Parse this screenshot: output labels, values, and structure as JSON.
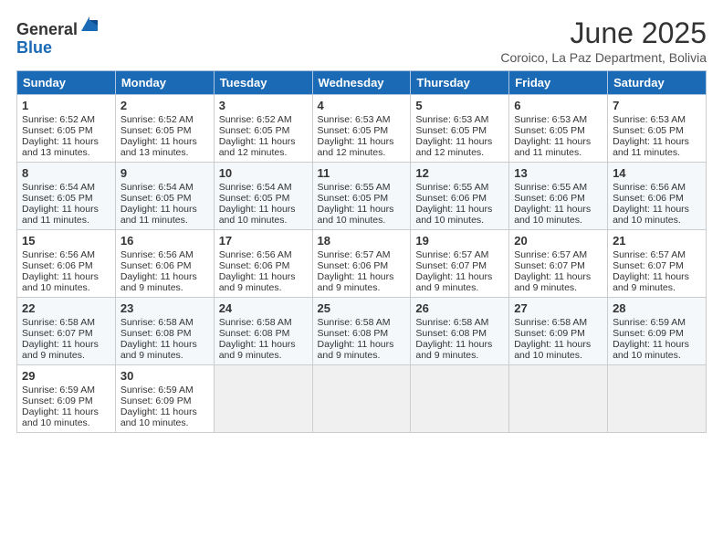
{
  "header": {
    "logo_general": "General",
    "logo_blue": "Blue",
    "title": "June 2025",
    "subtitle": "Coroico, La Paz Department, Bolivia"
  },
  "weekdays": [
    "Sunday",
    "Monday",
    "Tuesday",
    "Wednesday",
    "Thursday",
    "Friday",
    "Saturday"
  ],
  "weeks": [
    [
      {
        "day": "1",
        "sunrise": "6:52 AM",
        "sunset": "6:05 PM",
        "daylight": "11 hours and 13 minutes."
      },
      {
        "day": "2",
        "sunrise": "6:52 AM",
        "sunset": "6:05 PM",
        "daylight": "11 hours and 13 minutes."
      },
      {
        "day": "3",
        "sunrise": "6:52 AM",
        "sunset": "6:05 PM",
        "daylight": "11 hours and 12 minutes."
      },
      {
        "day": "4",
        "sunrise": "6:53 AM",
        "sunset": "6:05 PM",
        "daylight": "11 hours and 12 minutes."
      },
      {
        "day": "5",
        "sunrise": "6:53 AM",
        "sunset": "6:05 PM",
        "daylight": "11 hours and 12 minutes."
      },
      {
        "day": "6",
        "sunrise": "6:53 AM",
        "sunset": "6:05 PM",
        "daylight": "11 hours and 11 minutes."
      },
      {
        "day": "7",
        "sunrise": "6:53 AM",
        "sunset": "6:05 PM",
        "daylight": "11 hours and 11 minutes."
      }
    ],
    [
      {
        "day": "8",
        "sunrise": "6:54 AM",
        "sunset": "6:05 PM",
        "daylight": "11 hours and 11 minutes."
      },
      {
        "day": "9",
        "sunrise": "6:54 AM",
        "sunset": "6:05 PM",
        "daylight": "11 hours and 11 minutes."
      },
      {
        "day": "10",
        "sunrise": "6:54 AM",
        "sunset": "6:05 PM",
        "daylight": "11 hours and 10 minutes."
      },
      {
        "day": "11",
        "sunrise": "6:55 AM",
        "sunset": "6:05 PM",
        "daylight": "11 hours and 10 minutes."
      },
      {
        "day": "12",
        "sunrise": "6:55 AM",
        "sunset": "6:06 PM",
        "daylight": "11 hours and 10 minutes."
      },
      {
        "day": "13",
        "sunrise": "6:55 AM",
        "sunset": "6:06 PM",
        "daylight": "11 hours and 10 minutes."
      },
      {
        "day": "14",
        "sunrise": "6:56 AM",
        "sunset": "6:06 PM",
        "daylight": "11 hours and 10 minutes."
      }
    ],
    [
      {
        "day": "15",
        "sunrise": "6:56 AM",
        "sunset": "6:06 PM",
        "daylight": "11 hours and 10 minutes."
      },
      {
        "day": "16",
        "sunrise": "6:56 AM",
        "sunset": "6:06 PM",
        "daylight": "11 hours and 9 minutes."
      },
      {
        "day": "17",
        "sunrise": "6:56 AM",
        "sunset": "6:06 PM",
        "daylight": "11 hours and 9 minutes."
      },
      {
        "day": "18",
        "sunrise": "6:57 AM",
        "sunset": "6:06 PM",
        "daylight": "11 hours and 9 minutes."
      },
      {
        "day": "19",
        "sunrise": "6:57 AM",
        "sunset": "6:07 PM",
        "daylight": "11 hours and 9 minutes."
      },
      {
        "day": "20",
        "sunrise": "6:57 AM",
        "sunset": "6:07 PM",
        "daylight": "11 hours and 9 minutes."
      },
      {
        "day": "21",
        "sunrise": "6:57 AM",
        "sunset": "6:07 PM",
        "daylight": "11 hours and 9 minutes."
      }
    ],
    [
      {
        "day": "22",
        "sunrise": "6:58 AM",
        "sunset": "6:07 PM",
        "daylight": "11 hours and 9 minutes."
      },
      {
        "day": "23",
        "sunrise": "6:58 AM",
        "sunset": "6:08 PM",
        "daylight": "11 hours and 9 minutes."
      },
      {
        "day": "24",
        "sunrise": "6:58 AM",
        "sunset": "6:08 PM",
        "daylight": "11 hours and 9 minutes."
      },
      {
        "day": "25",
        "sunrise": "6:58 AM",
        "sunset": "6:08 PM",
        "daylight": "11 hours and 9 minutes."
      },
      {
        "day": "26",
        "sunrise": "6:58 AM",
        "sunset": "6:08 PM",
        "daylight": "11 hours and 9 minutes."
      },
      {
        "day": "27",
        "sunrise": "6:58 AM",
        "sunset": "6:09 PM",
        "daylight": "11 hours and 10 minutes."
      },
      {
        "day": "28",
        "sunrise": "6:59 AM",
        "sunset": "6:09 PM",
        "daylight": "11 hours and 10 minutes."
      }
    ],
    [
      {
        "day": "29",
        "sunrise": "6:59 AM",
        "sunset": "6:09 PM",
        "daylight": "11 hours and 10 minutes."
      },
      {
        "day": "30",
        "sunrise": "6:59 AM",
        "sunset": "6:09 PM",
        "daylight": "11 hours and 10 minutes."
      },
      null,
      null,
      null,
      null,
      null
    ]
  ]
}
